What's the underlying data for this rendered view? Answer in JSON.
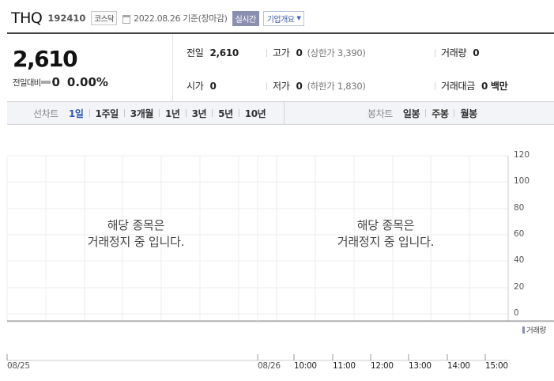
{
  "header": {
    "stock_name": "THQ",
    "stock_code": "192410",
    "market": "코스닥",
    "date_basis": "2022.08.26 기준(장마감)",
    "realtime_label": "실시간",
    "overview_label": "기업개요"
  },
  "quote": {
    "price": "2,610",
    "change_label": "전일대비",
    "change_value": "0",
    "change_rate": "0.00%",
    "prev_close_label": "전일",
    "prev_close": "2,610",
    "high_label": "고가",
    "high": "0",
    "upper_limit": "(상한가 3,390)",
    "volume_label": "거래량",
    "volume": "0",
    "open_label": "시가",
    "open": "0",
    "low_label": "저가",
    "low": "0",
    "lower_limit": "(하한가 1,830)",
    "amount_label": "거래대금",
    "amount": "0 백만"
  },
  "line_tabs": {
    "label": "선차트",
    "items": [
      "1일",
      "1주일",
      "3개월",
      "1년",
      "3년",
      "5년",
      "10년"
    ],
    "active": "1일"
  },
  "candle_tabs": {
    "label": "봉차트",
    "items": [
      "일봉",
      "주봉",
      "월봉"
    ]
  },
  "chart_data": {
    "type": "line",
    "title": "",
    "xlabel": "",
    "ylabel": "",
    "ylim": [
      0,
      120
    ],
    "y_ticks": [
      "120",
      "100",
      "80",
      "60",
      "40",
      "20",
      "0"
    ],
    "x_ticks": [
      "08/25",
      "08/26",
      "10:00",
      "11:00",
      "12:00",
      "13:00",
      "14:00",
      "15:00"
    ],
    "series": [],
    "grid": true,
    "legend": "bottom-right",
    "volume_legend": "거래량",
    "notice": [
      "해당 종목은",
      "거래정지 중 입니다."
    ],
    "panel_notice_count": 2
  },
  "colors": {
    "active_tab": "#2f59b6",
    "realtime_badge": "#8b8faf",
    "grid": "#eeeeee"
  }
}
